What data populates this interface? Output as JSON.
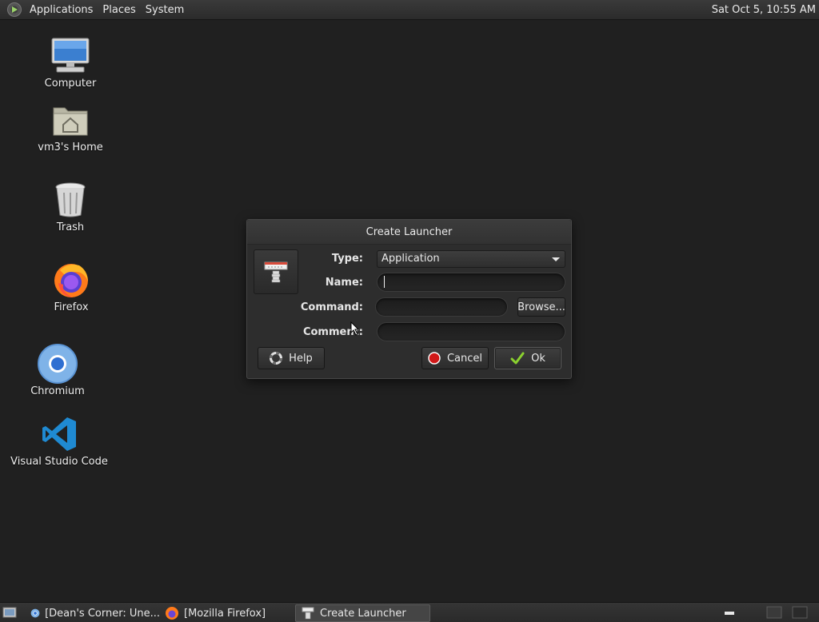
{
  "top_panel": {
    "menus": [
      "Applications",
      "Places",
      "System"
    ],
    "clock": "Sat Oct  5, 10:55 AM"
  },
  "desktop": {
    "icons": [
      {
        "label": "Computer",
        "icon": "computer-icon"
      },
      {
        "label": "vm3's Home",
        "icon": "home-folder-icon"
      },
      {
        "label": "Trash",
        "icon": "trash-icon"
      },
      {
        "label": "Firefox",
        "icon": "firefox-icon"
      },
      {
        "label": "Chromium",
        "icon": "chromium-icon"
      },
      {
        "label": "Visual Studio Code",
        "icon": "vscode-icon"
      }
    ]
  },
  "dialog": {
    "title": "Create Launcher",
    "type_label": "Type:",
    "type_value": "Application",
    "name_label": "Name:",
    "name_value": "",
    "command_label": "Command:",
    "command_value": "",
    "browse_label": "Browse...",
    "comment_label": "Comment:",
    "comment_value": "",
    "help_label": "Help",
    "cancel_label": "Cancel",
    "ok_label": "Ok"
  },
  "taskbar": {
    "tasks": [
      {
        "label": "[Dean's Corner: Une...",
        "icon": "chromium-icon",
        "active": false
      },
      {
        "label": "[Mozilla Firefox]",
        "icon": "firefox-icon",
        "active": false
      },
      {
        "label": "Create Launcher",
        "icon": "launcher-icon",
        "active": true
      }
    ]
  }
}
